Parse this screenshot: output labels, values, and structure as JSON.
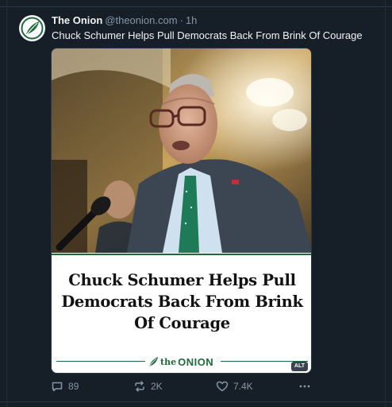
{
  "post": {
    "author": "The Onion",
    "handle": "@theonion.com",
    "separator": "·",
    "time": "1h",
    "text": "Chuck Schumer Helps Pull Democrats Back From Brink Of Courage",
    "avatar_icon": "onion-logo-icon"
  },
  "card": {
    "headline": "Chuck Schumer Helps Pull Democrats Back From Brink Of Courage",
    "brand_the": "the",
    "brand_onion": "ONION",
    "alt_badge": "ALT",
    "brand_color": "#1e6b3a"
  },
  "actions": {
    "replies": "89",
    "reposts": "2K",
    "likes": "7.4K"
  },
  "colors": {
    "background": "#161e27",
    "text_primary": "#f1f3f5",
    "text_secondary": "#8596a8"
  }
}
